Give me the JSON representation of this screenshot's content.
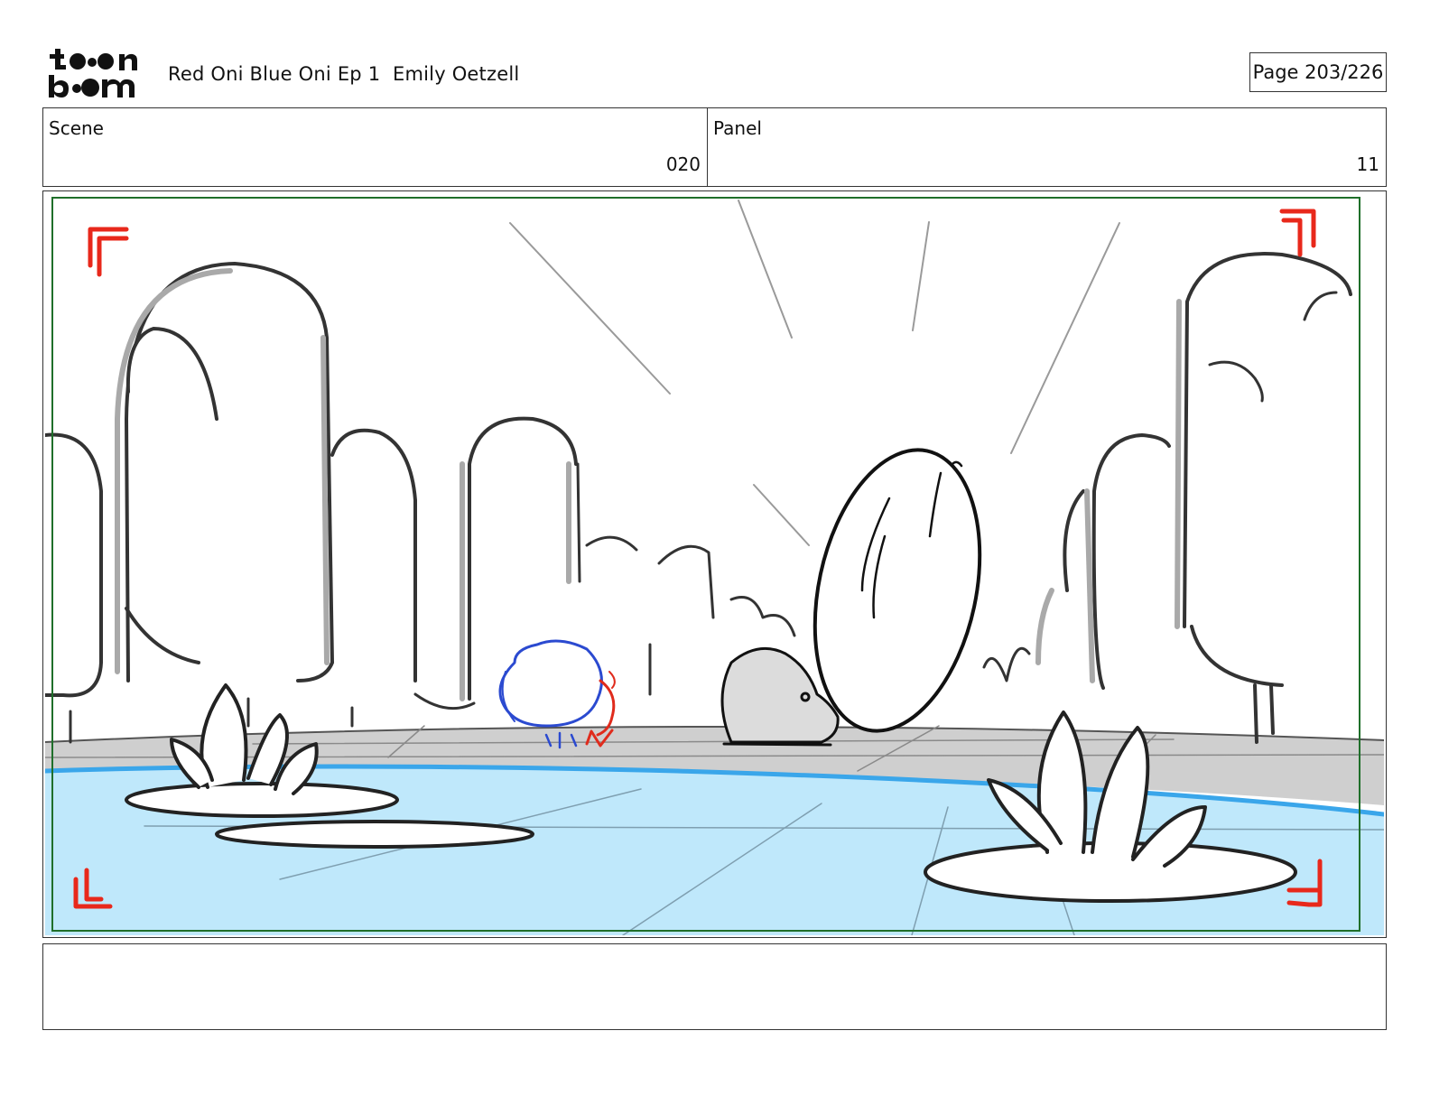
{
  "header": {
    "logo_text": "toon boom",
    "title": "Red Oni Blue Oni Ep 1  Emily Oetzell",
    "page_label": "Page 203/226"
  },
  "scene": {
    "label": "Scene",
    "value": "020"
  },
  "panel": {
    "label": "Panel",
    "value": "11"
  },
  "notes": {
    "text": ""
  },
  "colors": {
    "safe_area": "#1f6f2a",
    "corner_marks": "#e8281b",
    "water": "#bfe8fb",
    "water_edge": "#3aa6ea",
    "ground": "#c9c9c9",
    "ink": "#222222"
  }
}
